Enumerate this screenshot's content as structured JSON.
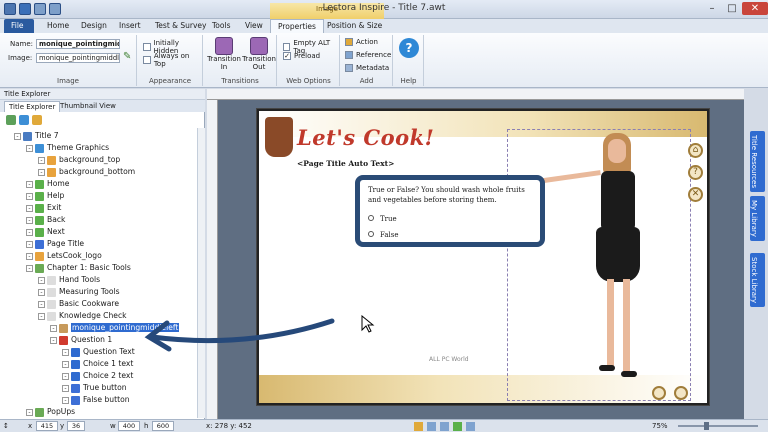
{
  "window": {
    "title": "Lectora Inspire - Title 7.awt",
    "context_group": "Image"
  },
  "tabs": [
    "File",
    "Home",
    "Design",
    "Insert",
    "Test & Survey",
    "Tools",
    "View",
    "Properties",
    "Position & Size"
  ],
  "ribbon": {
    "name_label": "Name:",
    "name_value": "monique_pointingmiddlel",
    "image_label": "Image:",
    "image_value": "monique_pointingmiddl",
    "initially_hidden": "Initially Hidden",
    "always_on_top": "Always on Top",
    "transition_in": "Transition In",
    "transition_out": "Transition Out",
    "empty_alt_tag": "Empty ALT Tag",
    "preload": "Preload",
    "action": "Action",
    "reference": "Reference",
    "metadata": "Metadata",
    "help": "Help",
    "groups": {
      "image": "Image",
      "appearance": "Appearance",
      "transitions": "Transitions",
      "web_options": "Web Options",
      "add": "Add",
      "help": "Help"
    }
  },
  "explorer": {
    "header": "Title Explorer",
    "tab_title": "Title Explorer",
    "tab_thumb": "Thumbnail View",
    "items": [
      {
        "label": "Title 7",
        "indent": 0,
        "icon": "#4a7cc2"
      },
      {
        "label": "Theme Graphics",
        "indent": 1,
        "icon": "#3d8fd6"
      },
      {
        "label": "background_top",
        "indent": 2,
        "icon": "#e8a33d"
      },
      {
        "label": "background_bottom",
        "indent": 2,
        "icon": "#e8a33d"
      },
      {
        "label": "Home",
        "indent": 1,
        "icon": "#5ab04a"
      },
      {
        "label": "Help",
        "indent": 1,
        "icon": "#5ab04a"
      },
      {
        "label": "Exit",
        "indent": 1,
        "icon": "#5ab04a"
      },
      {
        "label": "Back",
        "indent": 1,
        "icon": "#5ab04a"
      },
      {
        "label": "Next",
        "indent": 1,
        "icon": "#5ab04a"
      },
      {
        "label": "Page Title",
        "indent": 1,
        "icon": "#3d6fd6"
      },
      {
        "label": "LetsCook_logo",
        "indent": 1,
        "icon": "#e8a33d"
      },
      {
        "label": "Chapter 1: Basic Tools",
        "indent": 1,
        "icon": "#6aaa55"
      },
      {
        "label": "Hand Tools",
        "indent": 2,
        "icon": "#dddddd"
      },
      {
        "label": "Measuring Tools",
        "indent": 2,
        "icon": "#dddddd"
      },
      {
        "label": "Basic Cookware",
        "indent": 2,
        "icon": "#dddddd"
      },
      {
        "label": "Knowledge Check",
        "indent": 2,
        "icon": "#dddddd"
      },
      {
        "label": "monique_pointingmiddleleft",
        "indent": 3,
        "icon": "#c79a5b",
        "selected": true
      },
      {
        "label": "Question 1",
        "indent": 3,
        "icon": "#d03a2e"
      },
      {
        "label": "Question Text",
        "indent": 4,
        "icon": "#2f6bd0"
      },
      {
        "label": "Choice 1 text",
        "indent": 4,
        "icon": "#2f6bd0"
      },
      {
        "label": "Choice 2 text",
        "indent": 4,
        "icon": "#2f6bd0"
      },
      {
        "label": "True button",
        "indent": 4,
        "icon": "#3d6fd6"
      },
      {
        "label": "False button",
        "indent": 4,
        "icon": "#3d6fd6"
      },
      {
        "label": "PopUps",
        "indent": 1,
        "icon": "#6aaa55"
      }
    ]
  },
  "page": {
    "logo": "Let's Cook!",
    "page_title": "<Page Title Auto Text>",
    "question": "True or False? You should wash whole fruits and vegetables before storing them.",
    "choice_true": "True",
    "choice_false": "False",
    "watermark": "ALL PC World"
  },
  "dock": [
    "Title Resources",
    "My Library",
    "Stock Library"
  ],
  "status": {
    "x_label": "x",
    "x_value": "415",
    "y_label": "y",
    "y_value": "36",
    "w_label": "w",
    "w_value": "400",
    "h_label": "h",
    "h_value": "600",
    "coords": "x: 278  y: 452",
    "zoom": "75%"
  }
}
